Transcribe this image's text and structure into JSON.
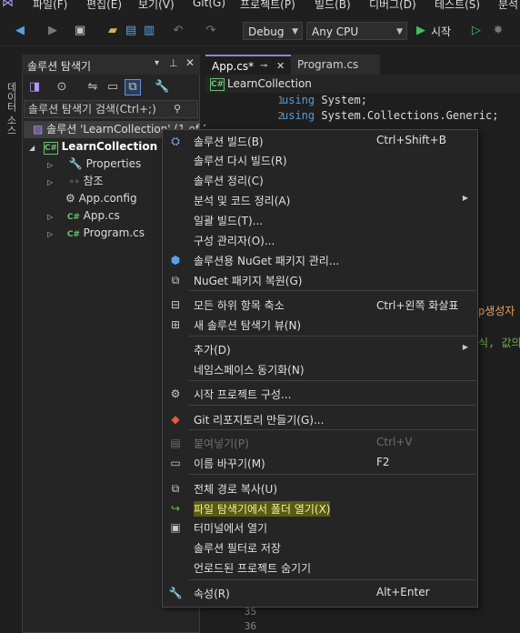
{
  "menubar": [
    "파일(F)",
    "편집(E)",
    "보기(V)",
    "Git(G)",
    "프로젝트(P)",
    "빌드(B)",
    "디버그(D)",
    "테스트(S)",
    "분석"
  ],
  "toolbar": {
    "config": "Debug",
    "platform": "Any CPU",
    "start_label": "시작"
  },
  "left_strip_label": "데이터 소스",
  "solution_explorer": {
    "title": "솔루션 탐색기",
    "search_placeholder": "솔루션 탐색기 검색(Ctrl+;)",
    "tree": [
      {
        "label": "솔루션 'LearnCollection' (1 of 1 project)",
        "icon": "solution-icon"
      },
      {
        "label": "LearnCollection",
        "icon": "csharp-project-icon"
      },
      {
        "label": "Properties",
        "icon": "wrench-icon"
      },
      {
        "label": "참조",
        "icon": "references-icon"
      },
      {
        "label": "App.config",
        "icon": "config-file-icon"
      },
      {
        "label": "App.cs",
        "icon": "csharp-file-icon"
      },
      {
        "label": "Program.cs",
        "icon": "csharp-file-icon"
      }
    ]
  },
  "editor": {
    "tabs": [
      "App.cs*",
      "Program.cs"
    ],
    "nav_project": "LearnCollection",
    "lines": [
      {
        "n": "1",
        "kw": "using",
        "rest": " System;"
      },
      {
        "n": "2",
        "kw": "using",
        "rest": " System.Collections.Generic;"
      }
    ],
    "bottom_lines": [
      "35",
      "36"
    ],
    "right_text_1": "p생성자",
    "right_text_2": "식, 값의"
  },
  "context_menu": {
    "items": [
      {
        "label": "솔루션 빌드(B)",
        "shortcut": "Ctrl+Shift+B",
        "icon": "build-icon"
      },
      {
        "label": "솔루션 다시 빌드(R)",
        "shortcut": ""
      },
      {
        "label": "솔루션 정리(C)",
        "shortcut": ""
      },
      {
        "label": "분석 및 코드 정리(A)",
        "shortcut": "",
        "submenu": true
      },
      {
        "label": "일괄 빌드(T)...",
        "shortcut": ""
      },
      {
        "label": "구성 관리자(O)...",
        "shortcut": ""
      },
      {
        "label": "솔루션용 NuGet 패키지 관리...",
        "shortcut": "",
        "icon": "nuget-icon"
      },
      {
        "label": "NuGet 패키지 복원(G)",
        "shortcut": "",
        "icon": "restore-icon"
      },
      {
        "label": "모든 하위 항목 축소",
        "shortcut": "Ctrl+왼쪽 화살표",
        "icon": "collapse-icon"
      },
      {
        "label": "새 솔루션 탐색기 뷰(N)",
        "shortcut": "",
        "icon": "new-view-icon"
      },
      {
        "label": "추가(D)",
        "shortcut": "",
        "submenu": true
      },
      {
        "label": "네임스페이스 동기화(N)",
        "shortcut": ""
      },
      {
        "label": "시작 프로젝트 구성...",
        "shortcut": "",
        "icon": "gear-icon"
      },
      {
        "label": "Git 리포지토리 만들기(G)...",
        "shortcut": "",
        "icon": "git-icon"
      },
      {
        "label": "붙여넣기(P)",
        "shortcut": "Ctrl+V",
        "icon": "paste-icon",
        "disabled": true
      },
      {
        "label": "이름 바꾸기(M)",
        "shortcut": "F2",
        "icon": "rename-icon"
      },
      {
        "label": "전체 경로 복사(U)",
        "shortcut": "",
        "icon": "copy-path-icon"
      },
      {
        "label": "파일 탐색기에서 폴더 열기(X)",
        "shortcut": "",
        "icon": "open-folder-icon",
        "highlighted": true
      },
      {
        "label": "터미널에서 열기",
        "shortcut": "",
        "icon": "terminal-icon"
      },
      {
        "label": "솔루션 필터로 저장",
        "shortcut": ""
      },
      {
        "label": "언로드된 프로젝트 숨기기",
        "shortcut": ""
      },
      {
        "label": "속성(R)",
        "shortcut": "Alt+Enter",
        "icon": "wrench-icon"
      }
    ]
  }
}
